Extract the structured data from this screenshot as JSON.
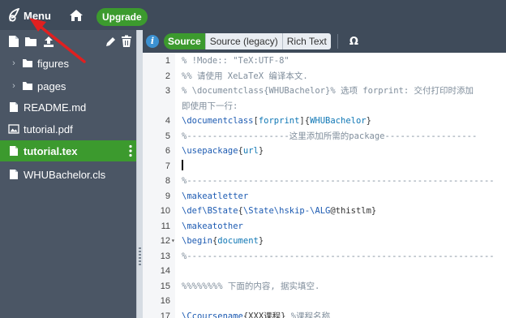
{
  "topbar": {
    "menu_label": "Menu",
    "upgrade_label": "Upgrade"
  },
  "file_tree": [
    {
      "name": "figures",
      "type": "folder"
    },
    {
      "name": "pages",
      "type": "folder"
    },
    {
      "name": "README.md",
      "type": "file"
    },
    {
      "name": "tutorial.pdf",
      "type": "image"
    },
    {
      "name": "tutorial.tex",
      "type": "file",
      "selected": true
    },
    {
      "name": "WHUBachelor.cls",
      "type": "file"
    }
  ],
  "editor_toolbar": {
    "tabs": [
      "Source",
      "Source (legacy)",
      "Rich Text"
    ],
    "active_tab": "Source",
    "symbol_label": "Ω"
  },
  "code_lines": [
    {
      "num": "1",
      "parts": [
        [
          "c-comment",
          "% !Mode:: \"TeX:UTF-8\""
        ]
      ]
    },
    {
      "num": "2",
      "parts": [
        [
          "c-comment",
          "%% 请使用 XeLaTeX 编译本文."
        ]
      ]
    },
    {
      "num": "3",
      "parts": [
        [
          "c-comment",
          "% \\documentclass{WHUBachelor}% 选项 forprint: 交付打印时添加"
        ]
      ]
    },
    {
      "num": "",
      "parts": [
        [
          "c-comment",
          "即使用下一行:"
        ]
      ]
    },
    {
      "num": "4",
      "parts": [
        [
          "c-cmd",
          "\\documentclass"
        ],
        [
          "c-plain",
          "["
        ],
        [
          "c-arg",
          "forprint"
        ],
        [
          "c-plain",
          "]{"
        ],
        [
          "c-arg",
          "WHUBachelor"
        ],
        [
          "c-plain",
          "}"
        ]
      ]
    },
    {
      "num": "5",
      "parts": [
        [
          "c-comment",
          "%--------------------这里添加所需的package------------------"
        ]
      ]
    },
    {
      "num": "6",
      "parts": [
        [
          "c-cmd",
          "\\usepackage"
        ],
        [
          "c-plain",
          "{"
        ],
        [
          "c-arg",
          "url"
        ],
        [
          "c-plain",
          "}"
        ]
      ]
    },
    {
      "num": "7",
      "parts": [],
      "current": true
    },
    {
      "num": "8",
      "parts": [
        [
          "c-comment",
          "%------------------------------------------------------------"
        ]
      ]
    },
    {
      "num": "9",
      "parts": [
        [
          "c-cmd",
          "\\makeatletter"
        ]
      ]
    },
    {
      "num": "10",
      "parts": [
        [
          "c-cmd",
          "\\def\\BState"
        ],
        [
          "c-plain",
          "{"
        ],
        [
          "c-cmd",
          "\\State\\hskip-\\ALG"
        ],
        [
          "c-plain",
          "@thistlm}"
        ]
      ]
    },
    {
      "num": "11",
      "parts": [
        [
          "c-cmd",
          "\\makeatother"
        ]
      ]
    },
    {
      "num": "12",
      "fold": true,
      "parts": [
        [
          "c-cmd",
          "\\begin"
        ],
        [
          "c-plain",
          "{"
        ],
        [
          "c-arg",
          "document"
        ],
        [
          "c-plain",
          "}"
        ]
      ]
    },
    {
      "num": "13",
      "parts": [
        [
          "c-comment",
          "%------------------------------------------------------------"
        ]
      ]
    },
    {
      "num": "14",
      "parts": []
    },
    {
      "num": "15",
      "parts": [
        [
          "c-comment",
          "%%%%%%%% 下面的内容, 据实填空."
        ]
      ]
    },
    {
      "num": "16",
      "parts": []
    },
    {
      "num": "17",
      "parts": [
        [
          "c-cmd",
          "\\Ccoursename"
        ],
        [
          "c-plain",
          "{XXX课程} "
        ],
        [
          "c-comment",
          "%课程名称"
        ]
      ]
    }
  ]
}
